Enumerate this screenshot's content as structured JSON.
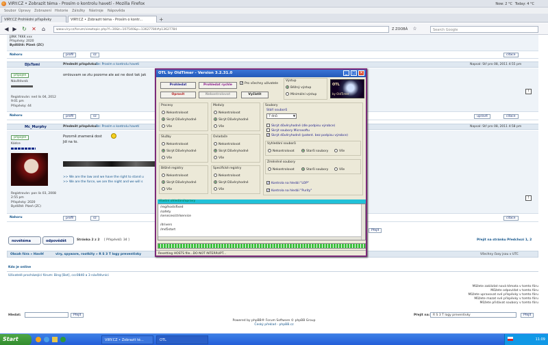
{
  "window": {
    "title": "VIRY.CZ • Zobrazit téma - Prosím o kontrolu havetí - Mozilla Firefox",
    "weather_now": "Now: 2 °C",
    "weather_today": "Today: 4 °C"
  },
  "menu": [
    "Soubor",
    "Úpravy",
    "Zobrazení",
    "Historie",
    "Záložky",
    "Nástroje",
    "Nápověda"
  ],
  "tabs": [
    {
      "label": "VIRY.CZ Prohlédni příspěvky"
    },
    {
      "label": "VIRY.CZ • Zobrazit téma - Prosím o kontr..."
    }
  ],
  "nav": {
    "url": "www.viry.cz/forum/viewtopic.php?f=30&t=107540&p=13627784#p13627784",
    "search_placeholder": "Search Google",
    "site_badge": "Z ZOOBÁ"
  },
  "posts": [
    {
      "author_tail": "JJINK 7KKK xxx",
      "posts_line": "Příspěvky: 2020",
      "bydliste": "Bydliště: Plzeň (ZC)",
      "nahoru": "Nahoru",
      "profile": "profil",
      "pm": "sz",
      "quote": "citace"
    },
    {
      "author": "DJsTomi",
      "subject_prefix": "Předmět příspěvku:",
      "subject": "Re: Prosím o kontrolu haveti",
      "date": "Napsal: Stř pro 08, 2011 4:55 pm",
      "rank_button": "připojen",
      "rank": "Návštěvník",
      "body": "omlouvam se ztu pozorne ale asi ne dost tak jak",
      "registered": "Registrován: ned lis 04, 2012 9:01 pm",
      "posts": "Příspěvky: 44",
      "nahoru": "Nahoru",
      "profile": "profil",
      "pm": "sz",
      "edit": "upravit",
      "quote": "citace"
    },
    {
      "author": "Mc_Murphy",
      "subject_prefix": "Předmět příspěvku:",
      "subject": "Re: Prosím o kontrolu havetí",
      "date": "Napsal: Stř pro 08, 2011 4:58 pm",
      "rank_button": "připojen",
      "rank": "Kádce",
      "body1": "Pozorně znamená dost",
      "body2": "Jdi na to.",
      "sig1": ">> We are the law and we have the right to stand u",
      "sig2": ">> We are the force, we are the night and we will s",
      "registered": "Registrován: pon lis 03, 2008 2:55 pm",
      "posts": "Příspěvky: 2020",
      "bydliste": "Bydliště: Plzeň (ZC)",
      "nahoru": "Nahoru",
      "profile": "profil",
      "pm": "sz",
      "quote": "citace"
    }
  ],
  "footer": {
    "new_topic": "novétéma",
    "reply": "odpovědět",
    "pages": "Stránka 2 z 2",
    "pages_tail": "[ Příspěvků: 34 ]",
    "goto_page": "Přejít na stránku Předchozí 1, 2",
    "prev_tab": "Přejít",
    "breadcrumb_prefix": "Obsah fóra » Havěť",
    "breadcrumb_tail": "viry, spyware, rootkity » R S 3 T logy  preventivky",
    "timezone": "Všechny časy jsou v UTC",
    "online_title": "Kdo je online",
    "online_text": "Uživatelé procházející fórum: Bing [Bot], ccc0840 a 3 návštěvníci",
    "perm1": "Můžete zakládat nová témata v tomto fóru",
    "perm2": "Můžete odpovídat v tomto fóru",
    "perm3": "Můžete upravovat své příspěvky v tomto fóru",
    "perm4": "Můžete mazat své příspěvky v tomto fóru",
    "perm5": "Můžete přidávat soubory v tomto fóru",
    "search_label": "Hledat:",
    "search_btn": "Přejít",
    "jump_label": "Přejít na:",
    "jump_value": "R S 3 T logy  preventivky",
    "jump_btn": "Přejít",
    "powered1": "Powered by phpBB® Forum Software © phpBB Group",
    "powered2": "Český překlad - phpBB.cz"
  },
  "dialog": {
    "title": "OTL by OldTimer - Version 3.2.31.0",
    "btn_prohledat": "Prohledat",
    "btn_rychle": "Prohledat rychle",
    "btn_opravit": "Opravit",
    "btn_nekontrolovat": "Nekontrolovat",
    "btn_vycisti": "Vyčistit",
    "chk_vse": "Pro všechny uživatele",
    "vystup_label": "Výstup",
    "vystup_opt1": "Běžný výstup",
    "vystup_opt2": "Minimální výstup",
    "logo_text": "OTL",
    "logo_sub": "by OldTimer",
    "opt_nek": "Nekontrolovat",
    "opt_sus": "Skrýt Důvěryhodné",
    "opt_vse": "Vše",
    "procesy": "Procesy",
    "moduly": "Moduly",
    "sluzby": "Služby",
    "ovladace": "Ovladače",
    "registry": "Běžné registry",
    "specregistry": "Specifické registry",
    "soubory": "Soubory",
    "stari": "Stáří souborů",
    "stari_val": "7 dnů",
    "c1": "Skrýt důvěryhodné (dle podpisu výrobce)",
    "c2": "Skrýt soubory Microsoftu",
    "c3": "Skrýt důvěryhodné (patent. bez podpisu výrobce)",
    "vyhl": "Vyhledání souborů",
    "vyhl1": "Nekontrolovat",
    "vyhl2": "Starší soubory",
    "vyhl3": "Vše",
    "zmen": "Změněné soubory",
    "zmen1": "Nekontrolovat",
    "zmen2": "Starší soubory",
    "zmen3": "Vše",
    "k1": "Kontrola na hledáí \"LOP\"",
    "k2": "Kontrola na hledáí \"Purity\"",
    "log_header": "Vlastní ohledání/opravy",
    "log_lines": [
      "/reg/hostsfixed",
      "/safety",
      "/services/ctrlservice",
      "",
      "/drivers",
      "/md5start"
    ],
    "progress": 1.0,
    "status": "Resetting HOSTS file...DO NOT INTERRUPT..."
  },
  "taskbar": {
    "start": "Start",
    "task1": "VIRY.CZ • Zobrazit té...",
    "task2": "OTL",
    "clock": "11:09"
  }
}
